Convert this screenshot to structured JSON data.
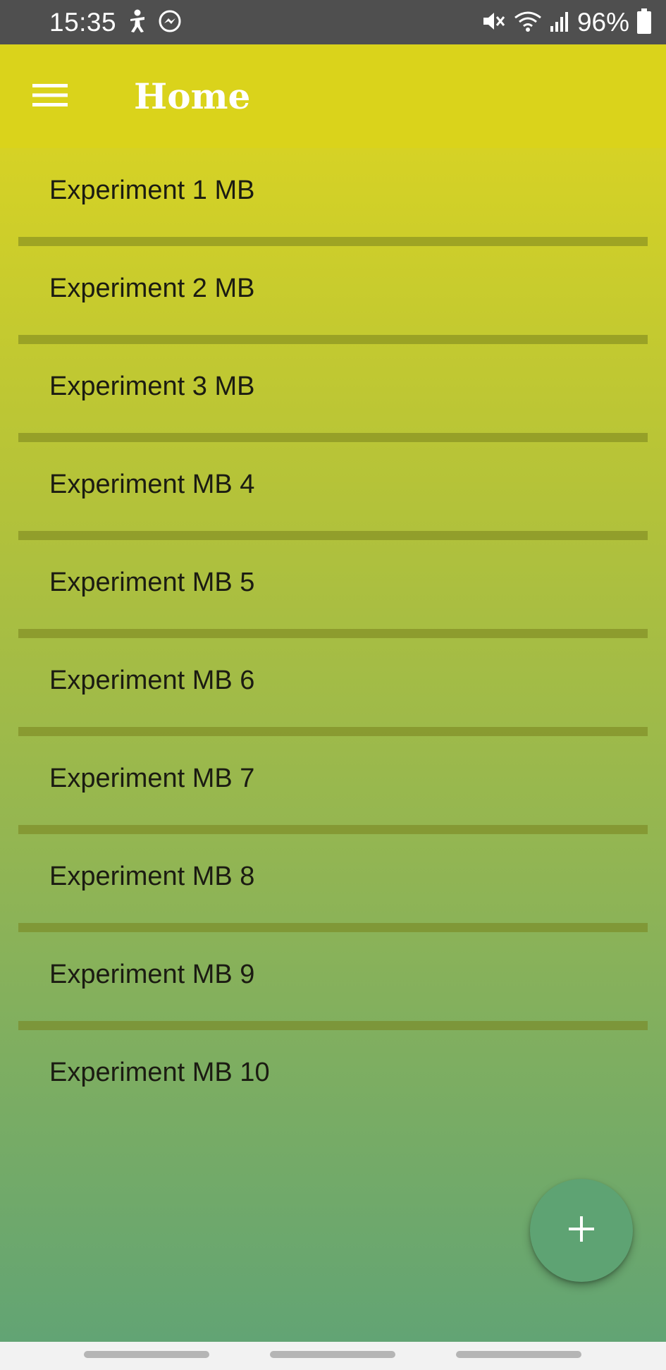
{
  "status_bar": {
    "time": "15:35",
    "left_icons": [
      "accessibility-icon",
      "messenger-icon"
    ],
    "right_icons": [
      "mute-icon",
      "wifi-icon",
      "signal-icon",
      "battery-icon"
    ],
    "battery_percent": "96%"
  },
  "app_bar": {
    "title": "Home",
    "menu_icon": "hamburger-menu-icon"
  },
  "experiments": [
    "Experiment 1 MB",
    "Experiment 2 MB",
    "Experiment 3 MB",
    "Experiment MB 4",
    "Experiment MB 5",
    "Experiment MB 6",
    "Experiment MB 7",
    "Experiment MB 8",
    "Experiment MB 9",
    "Experiment MB 10"
  ],
  "fab": {
    "icon": "plus-icon"
  },
  "colors": {
    "status_bar": "#4f4f4f",
    "app_bar": "#dad31b",
    "gradient_top": "#d6d225",
    "gradient_bottom": "#62a474",
    "fab": "#5ea373"
  }
}
